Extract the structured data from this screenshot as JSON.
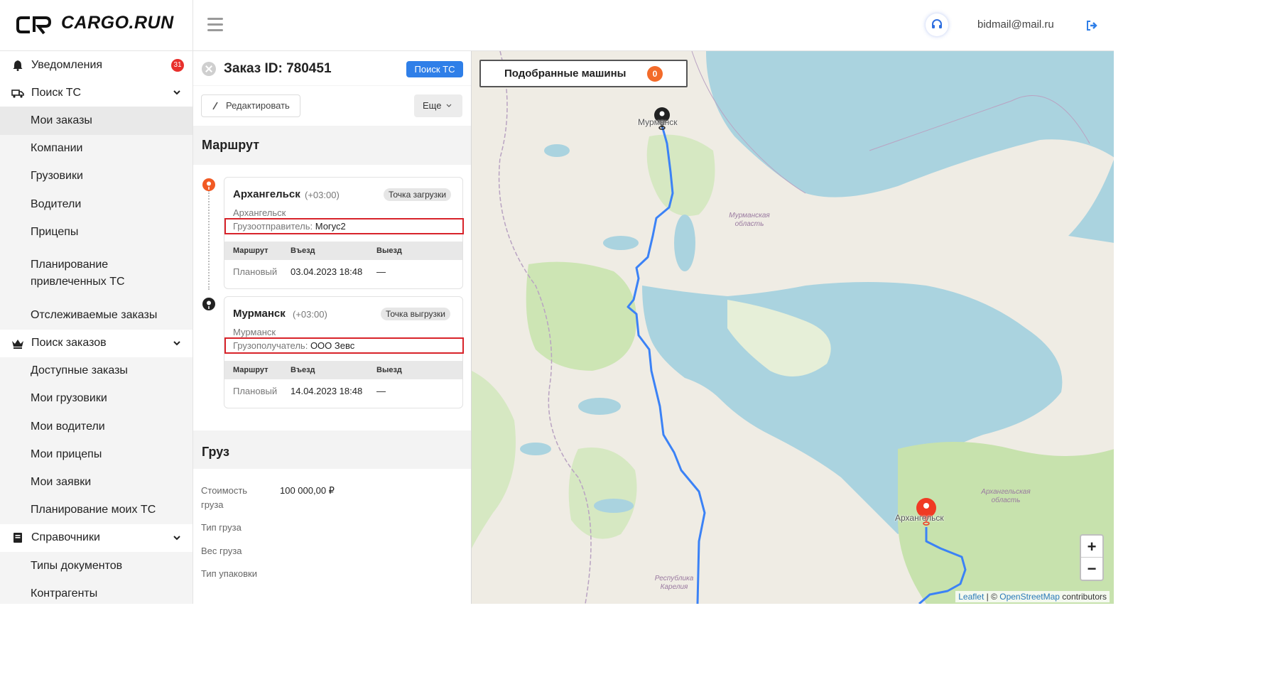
{
  "header": {
    "logo_text": "CARGO.RUN",
    "user_email": "bidmail@mail.ru"
  },
  "sidebar": {
    "notifications": {
      "label": "Уведомления",
      "badge": "31"
    },
    "search_vehicle": {
      "label": "Поиск ТС",
      "items": [
        "Мои заказы",
        "Компании",
        "Грузовики",
        "Водители",
        "Прицепы",
        "Планирование привлеченных ТС",
        "Отслеживаемые заказы"
      ]
    },
    "search_orders": {
      "label": "Поиск заказов",
      "items": [
        "Доступные заказы",
        "Мои грузовики",
        "Мои водители",
        "Мои прицепы",
        "Мои заявки",
        "Планирование моих ТС"
      ]
    },
    "references": {
      "label": "Справочники",
      "items": [
        "Типы документов",
        "Контрагенты"
      ]
    }
  },
  "order": {
    "title": "Заказ ID: 780451",
    "search_button": "Поиск ТС",
    "edit_button": "Редактировать",
    "more_button": "Еще",
    "route_title": "Маршрут",
    "cargo_title": "Груз",
    "stops": [
      {
        "city": "Архангельск",
        "tz": "(+03:00)",
        "tag": "Точка загрузки",
        "sub": "Архангельск",
        "party_label": "Грузоотправитель:",
        "party_value": "Могус2",
        "col_route": "Маршрут",
        "col_in": "Въезд",
        "col_out": "Выезд",
        "row_type": "Плановый",
        "row_in": "03.04.2023 18:48",
        "row_out": "—"
      },
      {
        "city": "Мурманск",
        "tz": "(+03:00)",
        "tag": "Точка выгрузки",
        "sub": "Мурманск",
        "party_label": "Грузополучатель:",
        "party_value": "ООО Зевс",
        "col_route": "Маршрут",
        "col_in": "Въезд",
        "col_out": "Выезд",
        "row_type": "Плановый",
        "row_in": "14.04.2023 18:48",
        "row_out": "—"
      }
    ],
    "cargo": {
      "cost_label": "Стоимость груза",
      "cost_value": "100 000,00 ₽",
      "type_label": "Тип груза",
      "weight_label": "Вес груза",
      "pack_label": "Тип упаковки"
    }
  },
  "map": {
    "matched_label": "Подобранные машины",
    "matched_count": "0",
    "city_murmansk": "Мурманск",
    "city_arkhangelsk": "Архангельск",
    "region_murmansk": "Мурманская область",
    "region_arkhangelsk": "Архангельская область",
    "region_karelia": "Республика Карелия",
    "zoom_in": "+",
    "zoom_out": "−",
    "attrib_leaflet": "Leaflet",
    "attrib_sep": " | © ",
    "attrib_osm": "OpenStreetMap",
    "attrib_tail": " contributors",
    "route_color": "#3b82f6"
  }
}
